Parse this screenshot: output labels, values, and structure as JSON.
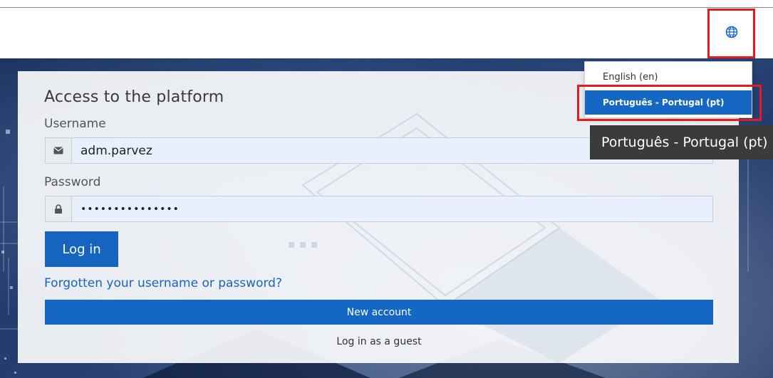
{
  "header": {
    "language_icon": "globe-icon"
  },
  "login": {
    "title": "Access to the platform",
    "username_label": "Username",
    "username_value": "adm.parvez",
    "username_icon": "envelope-icon",
    "password_label": "Password",
    "password_value": "•••••••••••••••",
    "password_icon": "lock-icon",
    "login_button": "Log in",
    "forgot_link": "Forgotten your username or password?",
    "new_account_button": "New account",
    "guest_link": "Log in as a guest"
  },
  "language_menu": {
    "items": [
      {
        "label": "English (en)",
        "selected": false
      },
      {
        "label": "Português - Portugal (pt)",
        "selected": true
      }
    ],
    "tooltip": "Português - Portugal (pt)"
  },
  "colors": {
    "primary": "#1467c2",
    "highlight_box": "#e01d23",
    "hero_bg": "#253f71",
    "tooltip_bg": "#3b3b3b"
  }
}
